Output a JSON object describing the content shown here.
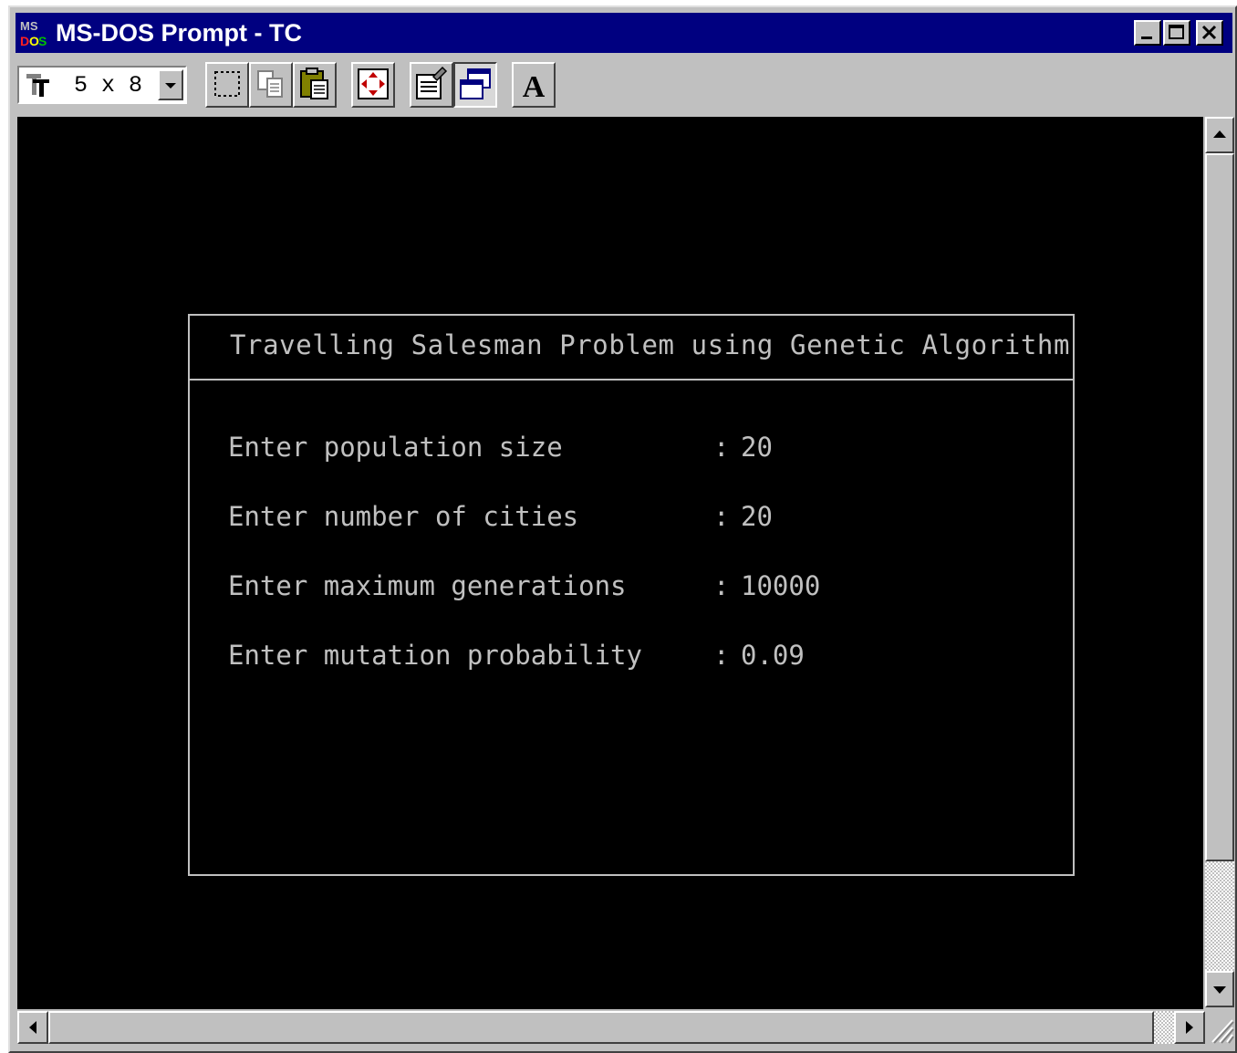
{
  "window": {
    "title": "MS-DOS Prompt - TC",
    "icon": "ms-dos-icon",
    "caption_buttons": [
      "minimize-icon",
      "maximize-icon",
      "close-icon"
    ]
  },
  "toolbar": {
    "font_size": "5 x 8",
    "buttons": [
      {
        "name": "mark-button",
        "icon": "mark-icon"
      },
      {
        "name": "copy-button",
        "icon": "copy-icon"
      },
      {
        "name": "paste-button",
        "icon": "paste-icon"
      },
      {
        "name": "fullscreen-button",
        "icon": "fullscreen-icon"
      },
      {
        "name": "properties-button",
        "icon": "properties-icon"
      },
      {
        "name": "background-button",
        "icon": "background-icon",
        "pressed": true
      },
      {
        "name": "font-button",
        "icon": "font-icon",
        "label": "A"
      }
    ]
  },
  "console": {
    "dialog_title": "Travelling Salesman Problem using Genetic Algorithm",
    "separator": ":",
    "rows": [
      {
        "label": "Enter population size",
        "value": "20"
      },
      {
        "label": "Enter number of cities",
        "value": "20"
      },
      {
        "label": "Enter maximum generations",
        "value": "10000"
      },
      {
        "label": "Enter mutation probability",
        "value": "0.09"
      }
    ]
  },
  "colors": {
    "titlebar": "#000080",
    "console_bg": "#000000",
    "console_text": "#c0c0c0",
    "chrome": "#c0c0c0"
  }
}
